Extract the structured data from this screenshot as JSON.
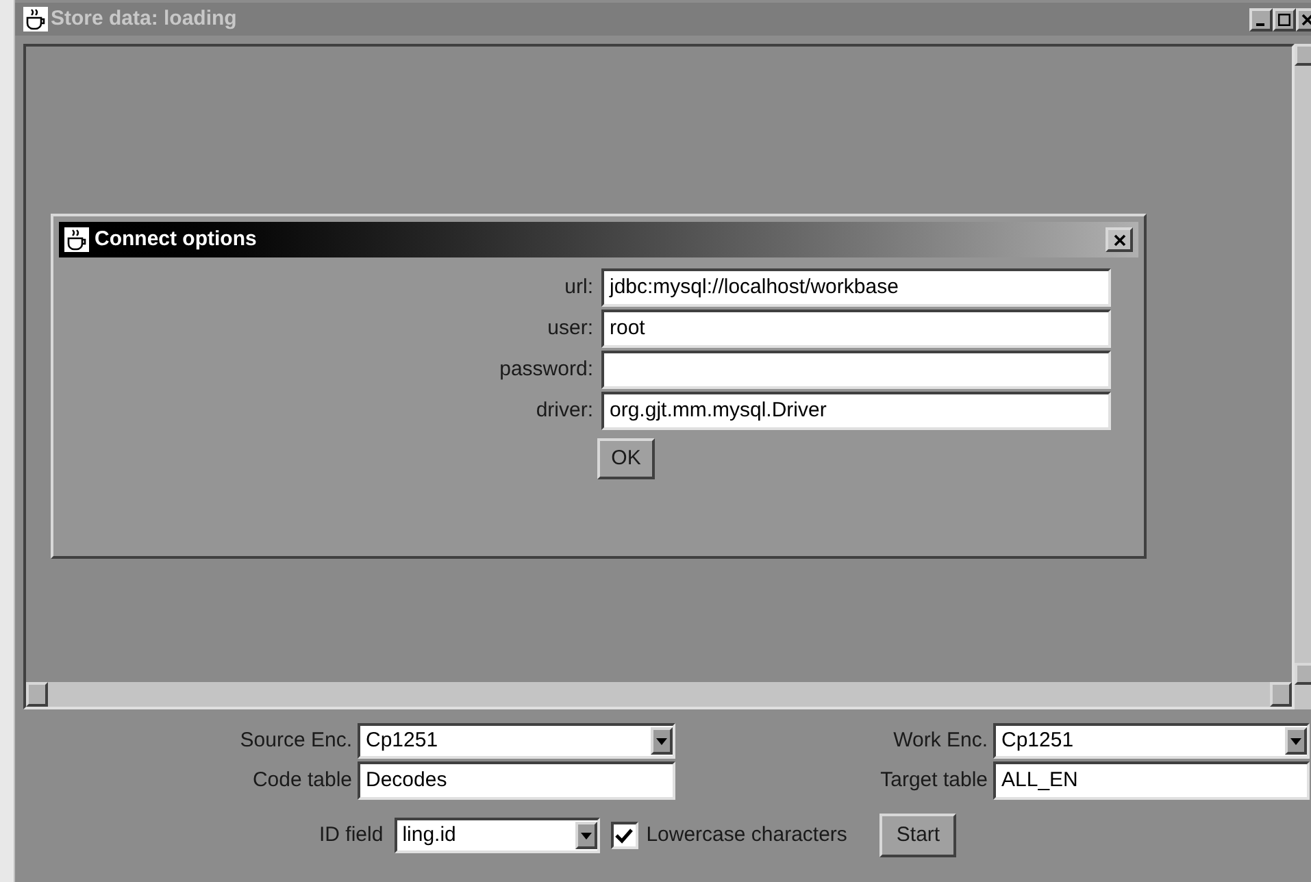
{
  "window": {
    "title": "Store data: loading"
  },
  "dialog": {
    "title": "Connect options",
    "fields": [
      {
        "label": "url:",
        "value": "jdbc:mysql://localhost/workbase"
      },
      {
        "label": "user:",
        "value": "root"
      },
      {
        "label": "password:"
      },
      {
        "label": "driver:",
        "value": "org.gjt.mm.mysql.Driver"
      }
    ],
    "button": "OK"
  },
  "settings": {
    "source_enc": {
      "label": "Source Enc.",
      "value": "Cp1251"
    },
    "work_enc": {
      "label": "Work Enc.",
      "value": "Cp1251"
    },
    "code_table": {
      "label": "Code table",
      "value": "Decodes"
    },
    "target_table": {
      "label": "Target table",
      "value": "ALL_EN"
    },
    "id_field": {
      "label": "ID field",
      "value": "ling.id"
    },
    "lowercase": {
      "label": "Lowercase characters",
      "checked": true
    },
    "start_button": "Start"
  }
}
